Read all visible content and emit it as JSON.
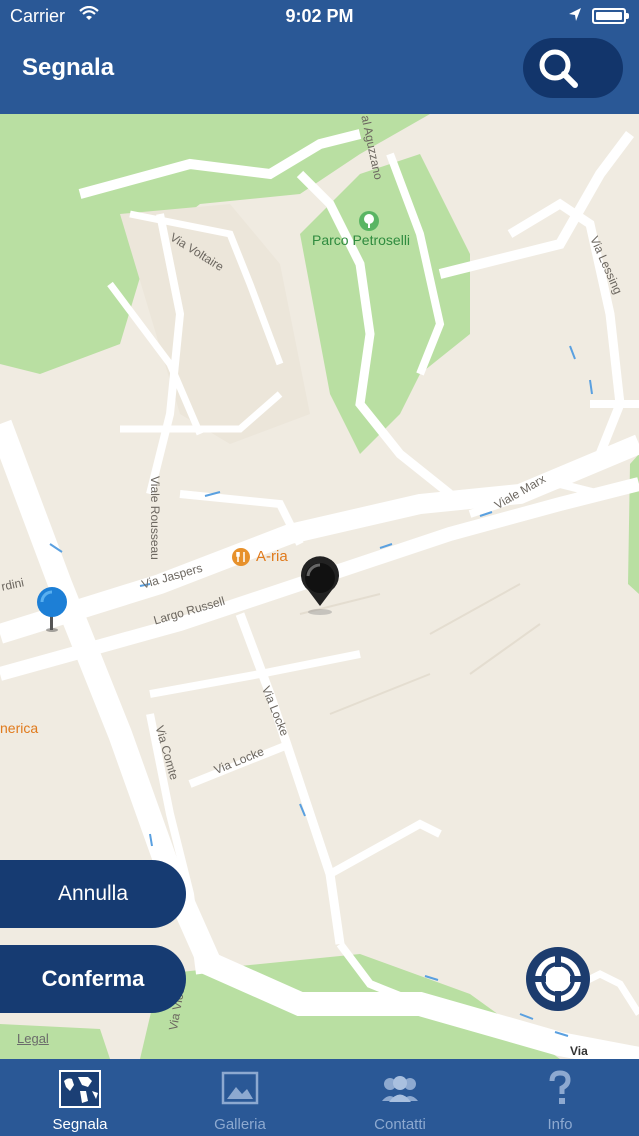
{
  "status_bar": {
    "carrier": "Carrier",
    "time": "9:02 PM"
  },
  "nav_bar": {
    "title": "Segnala",
    "search_icon": "search-icon"
  },
  "map": {
    "street_labels": [
      "Via Voltaire",
      "Parco Petroselli",
      "Via Lessing",
      "Viale Rousseau",
      "Viale Marx",
      "Via Jaspers",
      "Largo Russell",
      "A-ria",
      "Via Locke",
      "Via Comte",
      "Via Locke",
      "rdini",
      "nerica",
      "al Aguzzano",
      "Via Vico",
      "Via"
    ],
    "pins": [
      "marker-pin-blue",
      "marker-pin-black"
    ],
    "legal": "Legal"
  },
  "actions": {
    "cancel": "Annulla",
    "confirm": "Conferma"
  },
  "locate_icon": "crosshair-icon",
  "tab_bar": {
    "tabs": [
      {
        "label": "Segnala",
        "icon": "world-map-icon",
        "active": true
      },
      {
        "label": "Galleria",
        "icon": "gallery-icon",
        "active": false
      },
      {
        "label": "Contatti",
        "icon": "contacts-icon",
        "active": false
      },
      {
        "label": "Info",
        "icon": "question-icon",
        "active": false
      }
    ]
  },
  "colors": {
    "primary": "#2a5896",
    "button": "#163b72",
    "map_land": "#f0ebe1",
    "park": "#b9dfa2",
    "road": "#ffffff"
  }
}
